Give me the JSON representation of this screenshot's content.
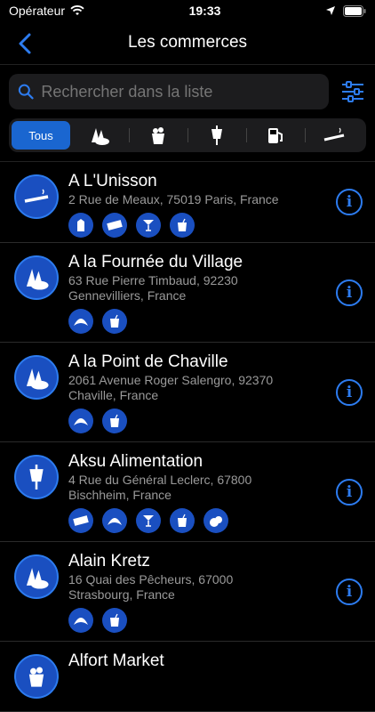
{
  "status": {
    "carrier": "Opérateur",
    "time": "19:33"
  },
  "nav": {
    "title": "Les commerces"
  },
  "search": {
    "placeholder": "Rechercher dans la liste"
  },
  "segments": {
    "all_label": "Tous"
  },
  "stores": [
    {
      "name": "A L'Unisson",
      "address": "2 Rue de Meaux, 75019 Paris, France"
    },
    {
      "name": "A la Fournée du Village",
      "address_line1": "63 Rue Pierre Timbaud, 92230",
      "address_line2": "Gennevilliers, France"
    },
    {
      "name": "A la Point de Chaville",
      "address_line1": "2061 Avenue Roger Salengro, 92370",
      "address_line2": "Chaville, France"
    },
    {
      "name": "Aksu Alimentation",
      "address_line1": "4 Rue du Général Leclerc, 67800",
      "address_line2": "Bischheim, France"
    },
    {
      "name": "Alain Kretz",
      "address_line1": "16 Quai des Pêcheurs, 67000",
      "address_line2": "Strasbourg, France"
    },
    {
      "name": "Alfort Market"
    }
  ],
  "colors": {
    "accent": "#2d7cf0",
    "badge": "#1a4fc0",
    "active_segment": "#1a66d0"
  }
}
